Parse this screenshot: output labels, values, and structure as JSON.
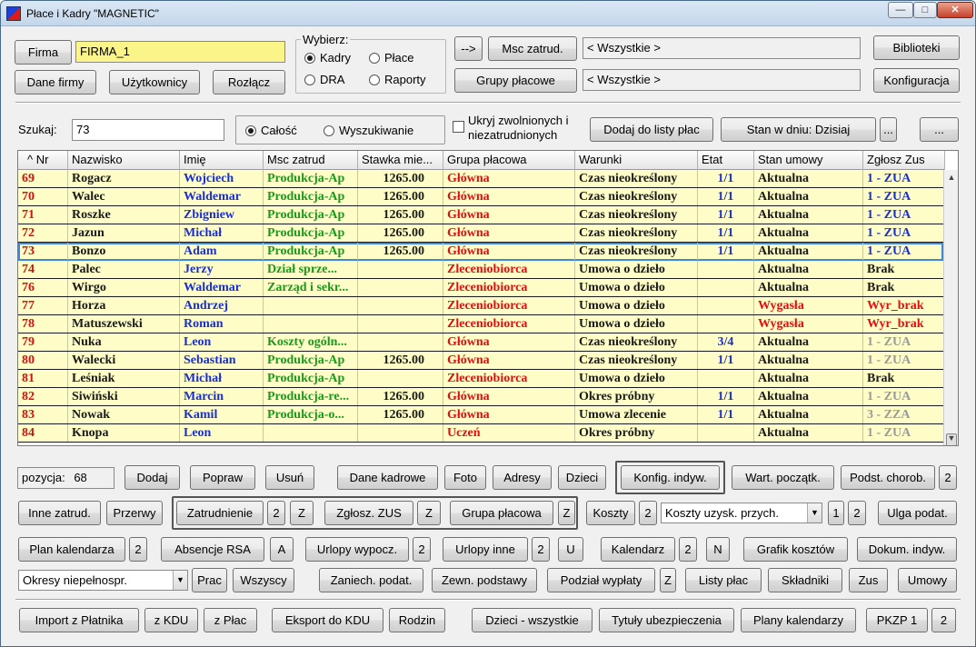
{
  "window": {
    "title": "Płace i Kadry \"MAGNETIC\"",
    "minimize": "—",
    "maximize": "□",
    "close": "✕"
  },
  "top": {
    "firma_btn": "Firma",
    "firma_value": "FIRMA_1",
    "dane_firmy": "Dane firmy",
    "uzytkownicy": "Użytkownicy",
    "rozlacz": "Rozłącz",
    "wybierz_title": "Wybierz:",
    "opt_kadry": "Kadry",
    "opt_place": "Płace",
    "opt_dra": "DRA",
    "opt_raporty": "Raporty",
    "arrow_btn": "-->",
    "msc_zatrud_btn": "Msc zatrud.",
    "msc_zatrud_value": "< Wszystkie >",
    "grupy_btn": "Grupy płacowe",
    "grupy_value": "< Wszystkie >",
    "biblioteki": "Biblioteki",
    "konfiguracja": "Konfiguracja"
  },
  "search": {
    "label": "Szukaj:",
    "value": "73",
    "opt_calosc": "Całość",
    "opt_wyszukiwanie": "Wyszukiwanie",
    "ukryj_line1": "Ukryj zwolnionych i",
    "ukryj_line2": "niezatrudnionych",
    "dodaj_lista": "Dodaj do listy płac",
    "stan_dniu": "Stan w dniu: Dzisiaj",
    "dots1": "...",
    "dots2": "..."
  },
  "grid": {
    "headers": [
      "^ Nr",
      "Nazwisko",
      "Imię",
      "Msc zatrud",
      "Stawka mie...",
      "Grupa płacowa",
      "Warunki",
      "Etat",
      "Stan umowy",
      "Zgłosz Zus"
    ],
    "rows": [
      {
        "nr": "69",
        "nazwisko": "Rogacz",
        "imie": "Wojciech",
        "msc": "Produkcja-Ap",
        "stawka": "1265.00",
        "grupa": "Główna",
        "warunki": "Czas nieokreślony",
        "etat": "1/1",
        "stan": "Aktualna",
        "zus": "1 - ZUA",
        "stan_red": false,
        "zus_color": "#1a2fd0"
      },
      {
        "nr": "70",
        "nazwisko": "Walec",
        "imie": "Waldemar",
        "msc": "Produkcja-Ap",
        "stawka": "1265.00",
        "grupa": "Główna",
        "warunki": "Czas nieokreślony",
        "etat": "1/1",
        "stan": "Aktualna",
        "zus": "1 - ZUA",
        "stan_red": false,
        "zus_color": "#1a2fd0"
      },
      {
        "nr": "71",
        "nazwisko": "Roszke",
        "imie": "Zbigniew",
        "msc": "Produkcja-Ap",
        "stawka": "1265.00",
        "grupa": "Główna",
        "warunki": "Czas nieokreślony",
        "etat": "1/1",
        "stan": "Aktualna",
        "zus": "1 - ZUA",
        "stan_red": false,
        "zus_color": "#1a2fd0"
      },
      {
        "nr": "72",
        "nazwisko": "Jazun",
        "imie": "Michał",
        "msc": "Produkcja-Ap",
        "stawka": "1265.00",
        "grupa": "Główna",
        "warunki": "Czas nieokreślony",
        "etat": "1/1",
        "stan": "Aktualna",
        "zus": "1 - ZUA",
        "stan_red": false,
        "zus_color": "#1a2fd0"
      },
      {
        "nr": "73",
        "nazwisko": "Bonzo",
        "imie": "Adam",
        "msc": "Produkcja-Ap",
        "stawka": "1265.00",
        "grupa": "Główna",
        "warunki": "Czas nieokreślony",
        "etat": "1/1",
        "stan": "Aktualna",
        "zus": "1 - ZUA",
        "stan_red": false,
        "zus_color": "#1a2fd0"
      },
      {
        "nr": "74",
        "nazwisko": "Palec",
        "imie": "Jerzy",
        "msc": "Dział sprze...",
        "stawka": "",
        "grupa": "Zleceniobiorca",
        "warunki": "Umowa o dzieło",
        "etat": "",
        "stan": "Aktualna",
        "zus": "Brak",
        "stan_red": false,
        "zus_color": "#1a1a1a"
      },
      {
        "nr": "76",
        "nazwisko": "Wirgo",
        "imie": "Waldemar",
        "msc": "Zarząd i sekr...",
        "stawka": "",
        "grupa": "Zleceniobiorca",
        "warunki": "Umowa o dzieło",
        "etat": "",
        "stan": "Aktualna",
        "zus": "Brak",
        "stan_red": false,
        "zus_color": "#1a1a1a"
      },
      {
        "nr": "77",
        "nazwisko": "Horza",
        "imie": "Andrzej",
        "msc": "",
        "stawka": "",
        "grupa": "Zleceniobiorca",
        "warunki": "Umowa o dzieło",
        "etat": "",
        "stan": "Wygasła",
        "zus": "Wyr_brak",
        "stan_red": true,
        "zus_color": "#e01010"
      },
      {
        "nr": "78",
        "nazwisko": "Matuszewski",
        "imie": "Roman",
        "msc": "",
        "stawka": "",
        "grupa": "Zleceniobiorca",
        "warunki": "Umowa o dzieło",
        "etat": "",
        "stan": "Wygasła",
        "zus": "Wyr_brak",
        "stan_red": true,
        "zus_color": "#e01010"
      },
      {
        "nr": "79",
        "nazwisko": "Nuka",
        "imie": "Leon",
        "msc": "Koszty ogóln...",
        "stawka": "",
        "grupa": "Główna",
        "warunki": "Czas nieokreślony",
        "etat": "3/4",
        "stan": "Aktualna",
        "zus": "1 - ZUA",
        "stan_red": false,
        "zus_color": "#9a9a9a"
      },
      {
        "nr": "80",
        "nazwisko": "Walecki",
        "imie": "Sebastian",
        "msc": "Produkcja-Ap",
        "stawka": "1265.00",
        "grupa": "Główna",
        "warunki": "Czas nieokreślony",
        "etat": "1/1",
        "stan": "Aktualna",
        "zus": "1 - ZUA",
        "stan_red": false,
        "zus_color": "#9a9a9a"
      },
      {
        "nr": "81",
        "nazwisko": "Leśniak",
        "imie": "Michał",
        "msc": "Produkcja-Ap",
        "stawka": "",
        "grupa": "Zleceniobiorca",
        "warunki": "Umowa o dzieło",
        "etat": "",
        "stan": "Aktualna",
        "zus": "Brak",
        "stan_red": false,
        "zus_color": "#1a1a1a"
      },
      {
        "nr": "82",
        "nazwisko": "Siwiński",
        "imie": "Marcin",
        "msc": "Produkcja-re...",
        "stawka": "1265.00",
        "grupa": "Główna",
        "warunki": "Okres próbny",
        "etat": "1/1",
        "stan": "Aktualna",
        "zus": "1 - ZUA",
        "stan_red": false,
        "zus_color": "#9a9a9a"
      },
      {
        "nr": "83",
        "nazwisko": "Nowak",
        "imie": "Kamil",
        "msc": "Produkcja-o...",
        "stawka": "1265.00",
        "grupa": "Główna",
        "warunki": "Umowa zlecenie",
        "etat": "1/1",
        "stan": "Aktualna",
        "zus": "3 - ZZA",
        "stan_red": false,
        "zus_color": "#9a9a9a"
      },
      {
        "nr": "84",
        "nazwisko": "Knopa",
        "imie": "Leon",
        "msc": "",
        "stawka": "",
        "grupa": "Uczeń",
        "warunki": "Okres próbny",
        "etat": "",
        "stan": "Aktualna",
        "zus": "1 - ZUA",
        "stan_red": false,
        "zus_color": "#9a9a9a"
      }
    ]
  },
  "bottom": {
    "pozycja_label": "pozycja:",
    "pozycja_value": "68",
    "dodaj": "Dodaj",
    "popraw": "Popraw",
    "usun": "Usuń",
    "dane_kadrowe": "Dane kadrowe",
    "foto": "Foto",
    "adresy": "Adresy",
    "dzieci": "Dzieci",
    "konfig_indyw": "Konfig. indyw.",
    "wart_poczatk": "Wart. początk.",
    "podst_chorob": "Podst. chorob.",
    "two": "2",
    "inne_zatrud": "Inne zatrud.",
    "przerwy": "Przerwy",
    "zatrudnienie": "Zatrudnienie",
    "z": "Z",
    "zglosz_zus": "Zgłosz. ZUS",
    "grupa_placowa": "Grupa płacowa",
    "koszty": "Koszty",
    "koszty_combo": "Koszty uzysk. przych.",
    "one": "1",
    "ulga_podat": "Ulga podat.",
    "plan_kalendarza": "Plan kalendarza",
    "absencje_rsa": "Absencje RSA",
    "a": "A",
    "urlopy_wypocz": "Urlopy wypocz.",
    "urlopy_inne": "Urlopy inne",
    "u": "U",
    "kalendarz": "Kalendarz",
    "n": "N",
    "grafik_kosztow": "Grafik kosztów",
    "dokum_indyw": "Dokum. indyw.",
    "okresy_combo": "Okresy niepełnospr.",
    "prac": "Prac",
    "wszyscy": "Wszyscy",
    "zaniech_podat": "Zaniech. podat.",
    "zewn_podstawy": "Zewn. podstawy",
    "podzial_wyplaty": "Podział wypłaty",
    "listy_plac": "Listy płac",
    "skladniki": "Składniki",
    "zus": "Zus",
    "umowy": "Umowy",
    "import_platnika": "Import z Płatnika",
    "z_kdu": "z KDU",
    "z_plac": "z Płac",
    "eksport_kdu": "Eksport do KDU",
    "rodzin": "Rodzin",
    "dzieci_wszystkie": "Dzieci - wszystkie",
    "tytuly_ubezp": "Tytuły ubezpieczenia",
    "plany_kalendarzy": "Plany kalendarzy",
    "pkzp1": "PKZP 1"
  },
  "colors": {
    "row_bg": "#fefdc8",
    "nr_red": "#d41010",
    "imie_blue": "#1a2fd0",
    "msc_green": "#1a9a1a",
    "grupa_red": "#e01010",
    "firma_yellow": "#fbf589",
    "select_outline": "#3a8ad8"
  },
  "icons": {
    "sort": "caret-up",
    "scroll_up": "triangle-up",
    "scroll_down": "triangle-down",
    "dropdown": "triangle-down"
  }
}
